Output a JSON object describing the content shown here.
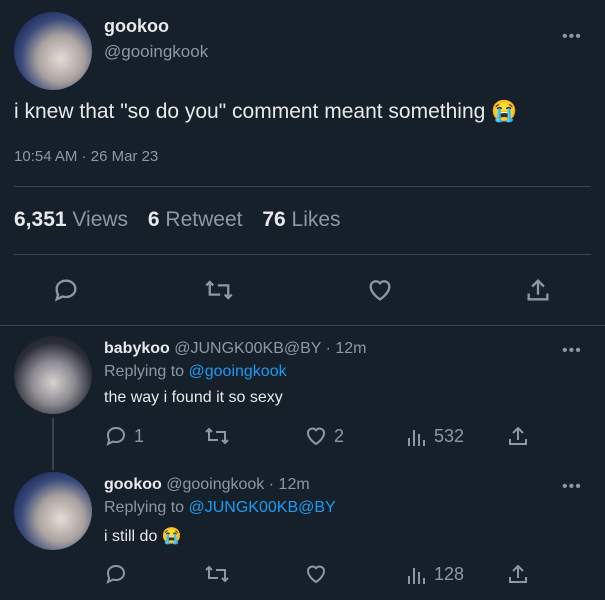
{
  "main_tweet": {
    "display_name": "gookoo",
    "handle": "@gooingkook",
    "text": "i knew that \"so do you\" comment meant something",
    "emoji": "😭",
    "time": "10:54 AM",
    "separator": "·",
    "date": "26 Mar 23",
    "stats": {
      "views_count": "6,351",
      "views_label": "Views",
      "retweets_count": "6",
      "retweets_label": "Retweet",
      "likes_count": "76",
      "likes_label": "Likes"
    }
  },
  "replies": [
    {
      "display_name": "babykoo",
      "handle": "@JUNGK00KB@BY",
      "time": "· 12m",
      "replying_prefix": "Replying to",
      "replying_to": "@gooingkook",
      "text": "the way i found it so sexy",
      "reply_count": "1",
      "like_count": "2",
      "views_count": "532"
    },
    {
      "display_name": "gookoo",
      "handle": "@gooingkook",
      "time": "· 12m",
      "replying_prefix": "Replying to",
      "replying_to": "@JUNGK00KB@BY",
      "text": "i still do",
      "emoji": "😭",
      "views_count": "128"
    }
  ],
  "menu_glyph": "•••",
  "colors": {
    "background": "#15202b",
    "accent": "#1d9bf0",
    "muted": "#8b98a5",
    "divider": "#38444d"
  }
}
